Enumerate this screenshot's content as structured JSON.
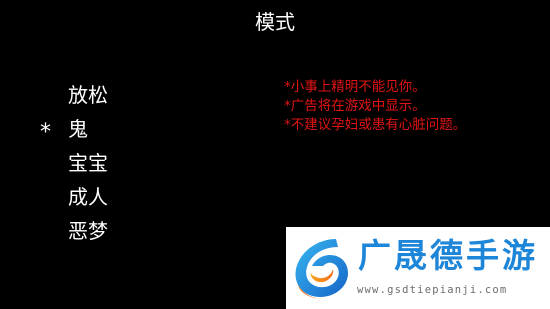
{
  "screen": {
    "title": "模式",
    "cursor": "*",
    "selected_index": 1,
    "options": [
      {
        "label": "放松"
      },
      {
        "label": "鬼"
      },
      {
        "label": "宝宝"
      },
      {
        "label": "成人"
      },
      {
        "label": "恶梦"
      }
    ],
    "warnings": [
      "*小事上精明不能见你。",
      "*广告将在游戏中显示。",
      "*不建议孕妇或患有心脏问题。"
    ],
    "colors": {
      "background": "#000000",
      "text": "#ffffff",
      "warning": "#e01414"
    }
  },
  "watermark": {
    "brand": "广晟德手游",
    "url": "www.gsdtiepianji.com",
    "icon": "gsd-logo-icon",
    "color": "#1e86d8"
  }
}
